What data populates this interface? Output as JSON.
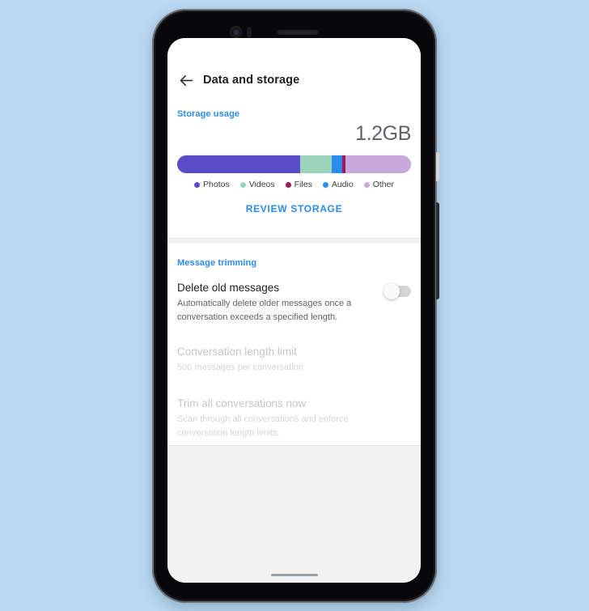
{
  "background_color": "#bcd9f2",
  "device": {
    "frame_color": "#0d0d0f",
    "power_button_color": "#d8d6d2",
    "volume_button_color": "#2b2c30"
  },
  "screen": {
    "header": {
      "back_icon": "arrow-left-icon",
      "title": "Data and storage"
    },
    "storage": {
      "section_label": "Storage usage",
      "total": "1.2GB",
      "review_button": "REVIEW STORAGE",
      "segments": [
        {
          "label": "Photos",
          "color": "#5b4dc7",
          "percent": 52.6
        },
        {
          "label": "Videos",
          "color": "#9bd3bb",
          "percent": 13.4
        },
        {
          "label": "Audio",
          "color": "#2b8cf0",
          "percent": 4.5
        },
        {
          "label": "Files",
          "color": "#9e1b55",
          "percent": 1.4
        },
        {
          "label": "Other",
          "color": "#c9a8dd",
          "percent": 28.1
        }
      ],
      "legend": [
        {
          "label": "Photos",
          "color": "#5b4dc7"
        },
        {
          "label": "Videos",
          "color": "#9bd3bb"
        },
        {
          "label": "Files",
          "color": "#9e1b55"
        },
        {
          "label": "Audio",
          "color": "#2b8cf0"
        },
        {
          "label": "Other",
          "color": "#c9a8dd"
        }
      ]
    },
    "message_trimming": {
      "section_label": "Message trimming",
      "rows": [
        {
          "title": "Delete old messages",
          "subtitle": "Automatically delete older messages once a conversation exceeds a specified length.",
          "toggle_state": "off",
          "enabled": true
        },
        {
          "title": "Conversation length limit",
          "subtitle": "500 messages per conversation",
          "enabled": false
        },
        {
          "title": "Trim all conversations now",
          "subtitle": "Scan through all conversations and enforce conversation length limits.",
          "enabled": false
        }
      ]
    },
    "navigation": {
      "gesture_bar": true
    }
  }
}
